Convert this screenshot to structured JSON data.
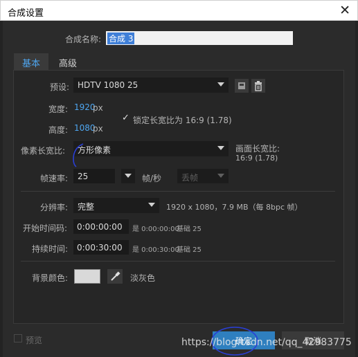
{
  "window": {
    "title": "合成设置",
    "close_glyph": "✕"
  },
  "comp_name": {
    "label": "合成名称:",
    "value": "合成 3"
  },
  "tabs": [
    {
      "label": "基本"
    },
    {
      "label": "高级"
    }
  ],
  "preset": {
    "label": "预设:",
    "value": "HDTV 1080 25"
  },
  "width": {
    "label": "宽度:",
    "value": "1920",
    "unit": "px"
  },
  "height": {
    "label": "高度:",
    "value": "1080",
    "unit": "px"
  },
  "lock_aspect": {
    "checked": true,
    "check_glyph": "✓",
    "label": "锁定长宽比为 16:9 (1.78)"
  },
  "pixel_aspect": {
    "label": "像素长宽比:",
    "value": "方形像素"
  },
  "frame_aspect": {
    "label": "画面长宽比:",
    "value": "16:9 (1.78)"
  },
  "frame_rate": {
    "label": "帧速率:",
    "value": "25",
    "unit": "帧/秒",
    "drop_frame": "丢帧"
  },
  "resolution": {
    "label": "分辨率:",
    "value": "完整",
    "info": "1920 x 1080，7.9 MB（每 8bpc 帧）"
  },
  "start_timecode": {
    "label": "开始时间码:",
    "value": "0:00:00:00",
    "info": "是 0:00:00:00",
    "base": "基础 25"
  },
  "duration": {
    "label": "持续时间:",
    "value": "0:00:30:00",
    "info": "是 0:00:30:00",
    "base": "基础 25"
  },
  "background": {
    "label": "背景颜色:",
    "color": "#d9d9d9",
    "color_name": "淡灰色"
  },
  "footer": {
    "preview_label": "预览",
    "ok_label": "确定",
    "cancel_label": "取消",
    "watermark": "https://blog.csdn.net/qq_42983775"
  },
  "colors": {
    "accent": "#4ea6f0",
    "ok_button": "#2f7fbf",
    "dialog_bg": "#2b2b2b",
    "panel_bg": "#232323"
  }
}
